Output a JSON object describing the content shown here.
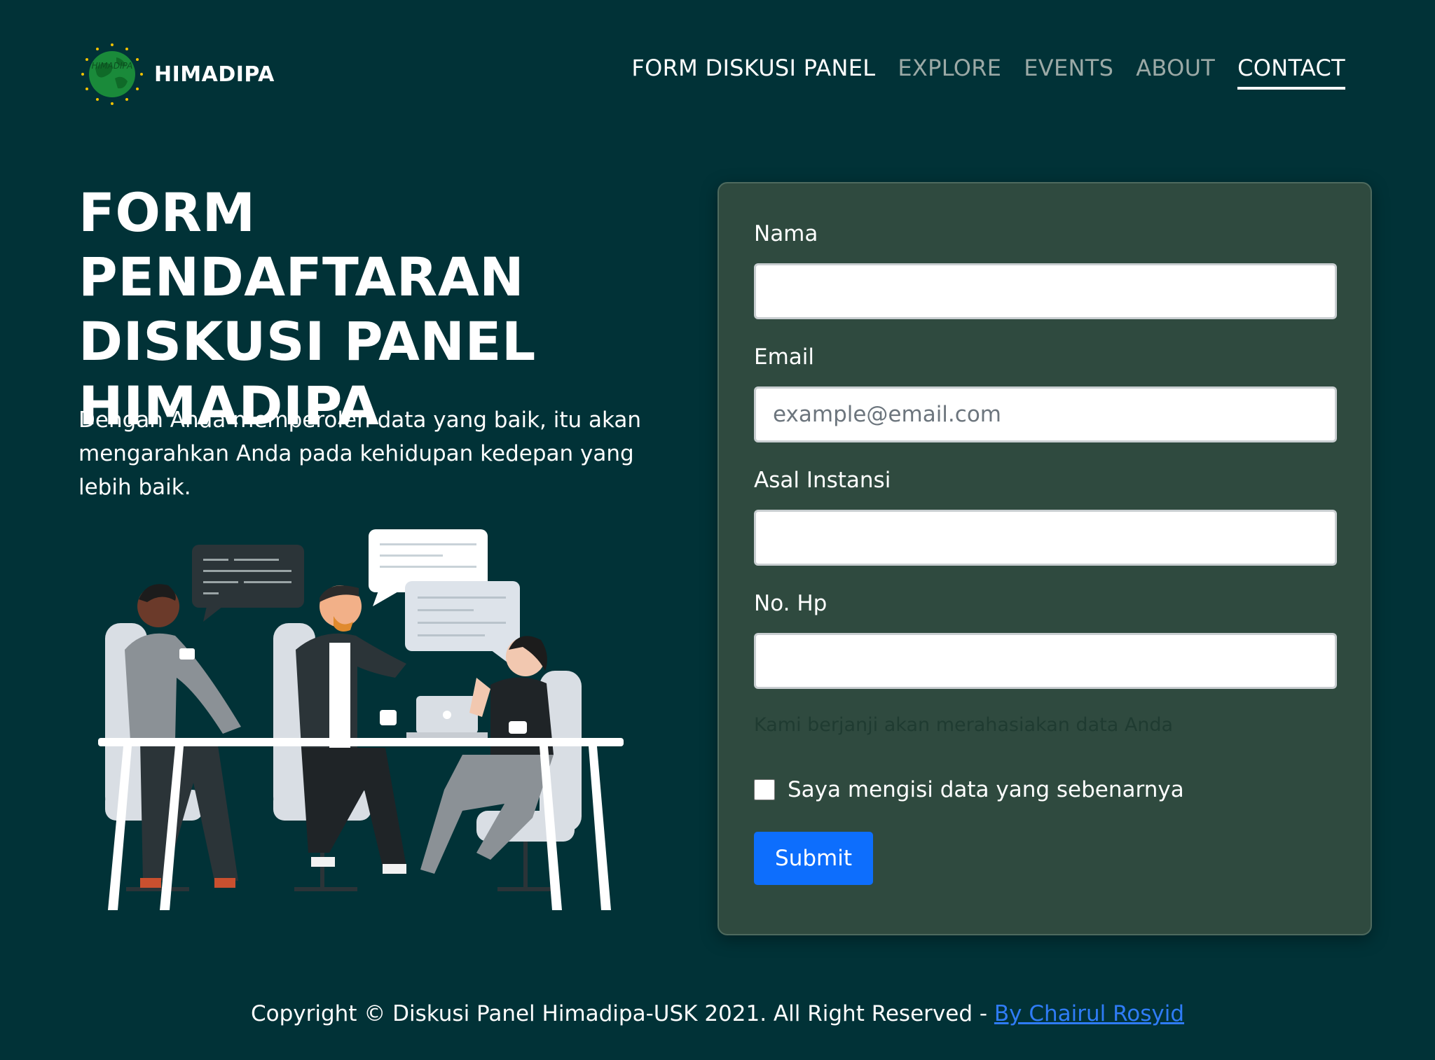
{
  "brand": {
    "name": "HIMADIPA",
    "logo_icon": "himadipa-globe-logo",
    "logo_text": "HIMADIPA"
  },
  "nav": {
    "items": [
      {
        "label": "FORM DISKUSI PANEL"
      },
      {
        "label": "EXPLORE"
      },
      {
        "label": "EVENTS"
      },
      {
        "label": "ABOUT"
      },
      {
        "label": "CONTACT",
        "active": true
      }
    ]
  },
  "hero": {
    "title_lines": [
      "FORM PENDAFTARAN",
      "DISKUSI PANEL",
      "HIMADIPA"
    ],
    "description": "Dengan Anda memperoleh data yang baik, itu akan mengarahkan Anda pada kehidupan kedepan yang lebih baik.",
    "illustration_icon": "team-discussion-illustration"
  },
  "form": {
    "fields": [
      {
        "label": "Nama",
        "value": "",
        "placeholder": ""
      },
      {
        "label": "Email",
        "value": "",
        "placeholder": "example@email.com"
      },
      {
        "label": "Asal Instansi",
        "value": "",
        "placeholder": ""
      },
      {
        "label": "No. Hp",
        "value": "",
        "placeholder": ""
      }
    ],
    "helper_text": "Kami berjanji akan merahasiakan data Anda",
    "checkbox_label": "Saya mengisi data yang sebenarnya",
    "checkbox_checked": false,
    "submit_label": "Submit"
  },
  "footer": {
    "copyright": "Copyright © Diskusi Panel Himadipa-USK 2021. All Right Reserved -",
    "author_link": "By Chairul Rosyid"
  },
  "colors": {
    "page_bg": "#013237",
    "card_bg": "#2f4a3f",
    "primary_button": "#0d6efd",
    "link": "#2f7cf6",
    "logo_green": "#1a8a3a"
  }
}
